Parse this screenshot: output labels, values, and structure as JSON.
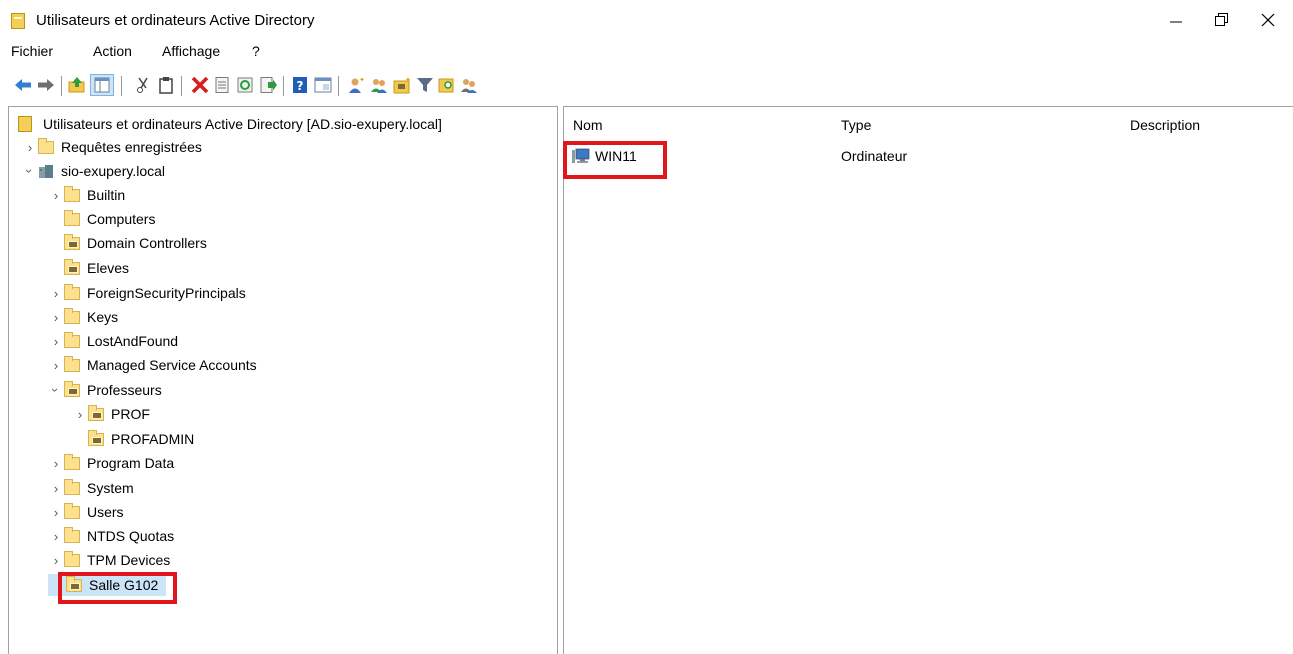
{
  "window": {
    "title": "Utilisateurs et ordinateurs Active Directory",
    "app_icon": "ad-console-icon",
    "controls": {
      "minimize": "minimize-icon",
      "maximize": "restore-icon",
      "close": "close-icon"
    }
  },
  "menu": {
    "items": [
      {
        "label": "Fichier"
      },
      {
        "label": "Action"
      },
      {
        "label": "Affichage"
      },
      {
        "label": "?"
      }
    ]
  },
  "toolbar": {
    "icons": [
      "back-arrow-icon",
      "forward-arrow-icon",
      "up-folder-icon",
      "show-hide-tree-icon",
      "cut-icon",
      "paste-icon",
      "delete-icon",
      "properties-icon",
      "refresh-icon",
      "export-list-icon",
      "help-icon",
      "console-tree-icon",
      "new-user-icon",
      "new-group-icon",
      "new-ou-icon",
      "filter-icon",
      "find-icon",
      "add-to-group-icon"
    ]
  },
  "tree": {
    "root": "Utilisateurs et ordinateurs Active Directory [AD.sio-exupery.local]",
    "saved_queries": "Requêtes enregistrées",
    "domain": "sio-exupery.local",
    "children": [
      {
        "label": "Builtin"
      },
      {
        "label": "Computers"
      },
      {
        "label": "Domain Controllers"
      },
      {
        "label": "Eleves"
      },
      {
        "label": "ForeignSecurityPrincipals"
      },
      {
        "label": "Keys"
      },
      {
        "label": "LostAndFound"
      },
      {
        "label": "Managed Service Accounts"
      },
      {
        "label": "Professeurs"
      },
      {
        "label": "PROF"
      },
      {
        "label": "PROFADMIN"
      },
      {
        "label": "Program Data"
      },
      {
        "label": "System"
      },
      {
        "label": "Users"
      },
      {
        "label": "NTDS Quotas"
      },
      {
        "label": "TPM Devices"
      },
      {
        "label": "Salle G102"
      }
    ]
  },
  "list": {
    "columns": {
      "name": "Nom",
      "type": "Type",
      "description": "Description"
    },
    "rows": [
      {
        "name": "WIN11",
        "type": "Ordinateur",
        "description": ""
      }
    ]
  },
  "colors": {
    "highlight": "#e1161c",
    "selection": "#cce4f7",
    "folder": "#fbe08e"
  }
}
